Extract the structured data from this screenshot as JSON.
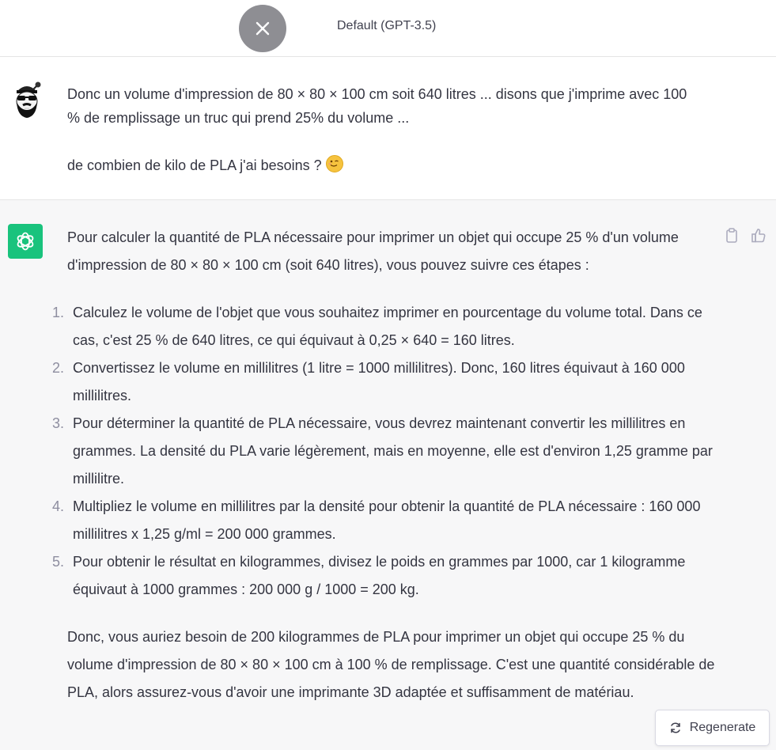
{
  "header": {
    "model_label": "Default (GPT-3.5)",
    "close_icon": "close-icon"
  },
  "user_message": {
    "avatar": "user-avatar",
    "paragraph_1": "Donc un volume d'impression de 80 × 80 × 100 cm soit 640 litres ... disons que j'imprime avec 100 % de remplissage un truc qui prend 25% du volume ...",
    "paragraph_2": "de combien de kilo de PLA j'ai besoins ?",
    "emoji": "wink-emoji"
  },
  "assistant_message": {
    "avatar": "openai-logo-icon",
    "intro": "Pour calculer la quantité de PLA nécessaire pour imprimer un objet qui occupe 25 % d'un volume d'impression de 80 × 80 × 100 cm (soit 640 litres), vous pouvez suivre ces étapes :",
    "steps": [
      {
        "num": "1.",
        "text": "Calculez le volume de l'objet que vous souhaitez imprimer en pourcentage du volume total. Dans ce cas, c'est 25 % de 640 litres, ce qui équivaut à 0,25 × 640 = 160 litres."
      },
      {
        "num": "2.",
        "text": "Convertissez le volume en millilitres (1 litre = 1000 millilitres). Donc, 160 litres équivaut à 160 000 millilitres."
      },
      {
        "num": "3.",
        "text": "Pour déterminer la quantité de PLA nécessaire, vous devrez maintenant convertir les millilitres en grammes. La densité du PLA varie légèrement, mais en moyenne, elle est d'environ 1,25 gramme par millilitre."
      },
      {
        "num": "4.",
        "text": "Multipliez le volume en millilitres par la densité pour obtenir la quantité de PLA nécessaire : 160 000 millilitres x 1,25 g/ml = 200 000 grammes."
      },
      {
        "num": "5.",
        "text": "Pour obtenir le résultat en kilogrammes, divisez le poids en grammes par 1000, car 1 kilogramme équivaut à 1000 grammes : 200 000 g / 1000 = 200 kg."
      }
    ],
    "conclusion": "Donc, vous auriez besoin de 200 kilogrammes de PLA pour imprimer un objet qui occupe 25 % du volume d'impression de 80 × 80 × 100 cm à 100 % de remplissage. C'est une quantité considérable de PLA, alors assurez-vous d'avoir une imprimante 3D adaptée et suffisamment de matériau.",
    "actions": [
      "copy-icon",
      "thumbs-up-icon"
    ]
  },
  "regenerate": {
    "label": "Regenerate",
    "icon": "refresh-icon"
  }
}
